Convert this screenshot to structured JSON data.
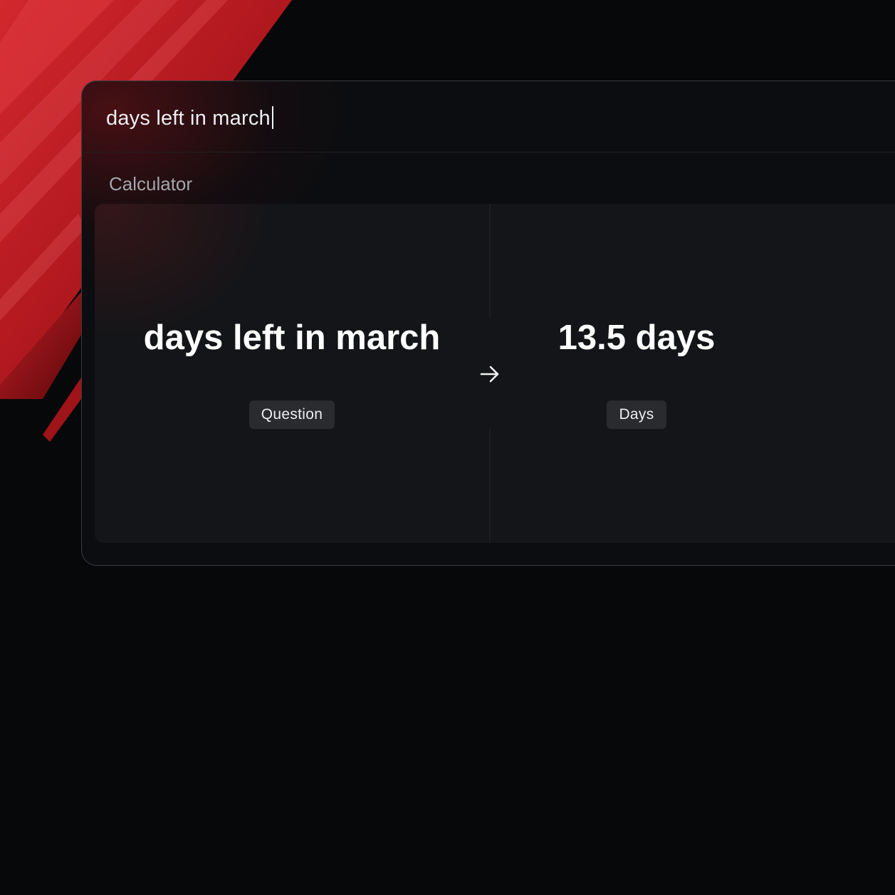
{
  "search": {
    "query": "days left in march"
  },
  "section": {
    "title": "Calculator"
  },
  "calculator": {
    "question": "days left in march",
    "question_label": "Question",
    "answer": "13.5 days",
    "answer_label": "Days",
    "arrow_icon": "arrow-right-icon"
  },
  "colors": {
    "background": "#07080a",
    "window": "#0c0d10",
    "card": "#141518",
    "badge": "#2a2b2f",
    "accent_red": "#c4141c"
  }
}
